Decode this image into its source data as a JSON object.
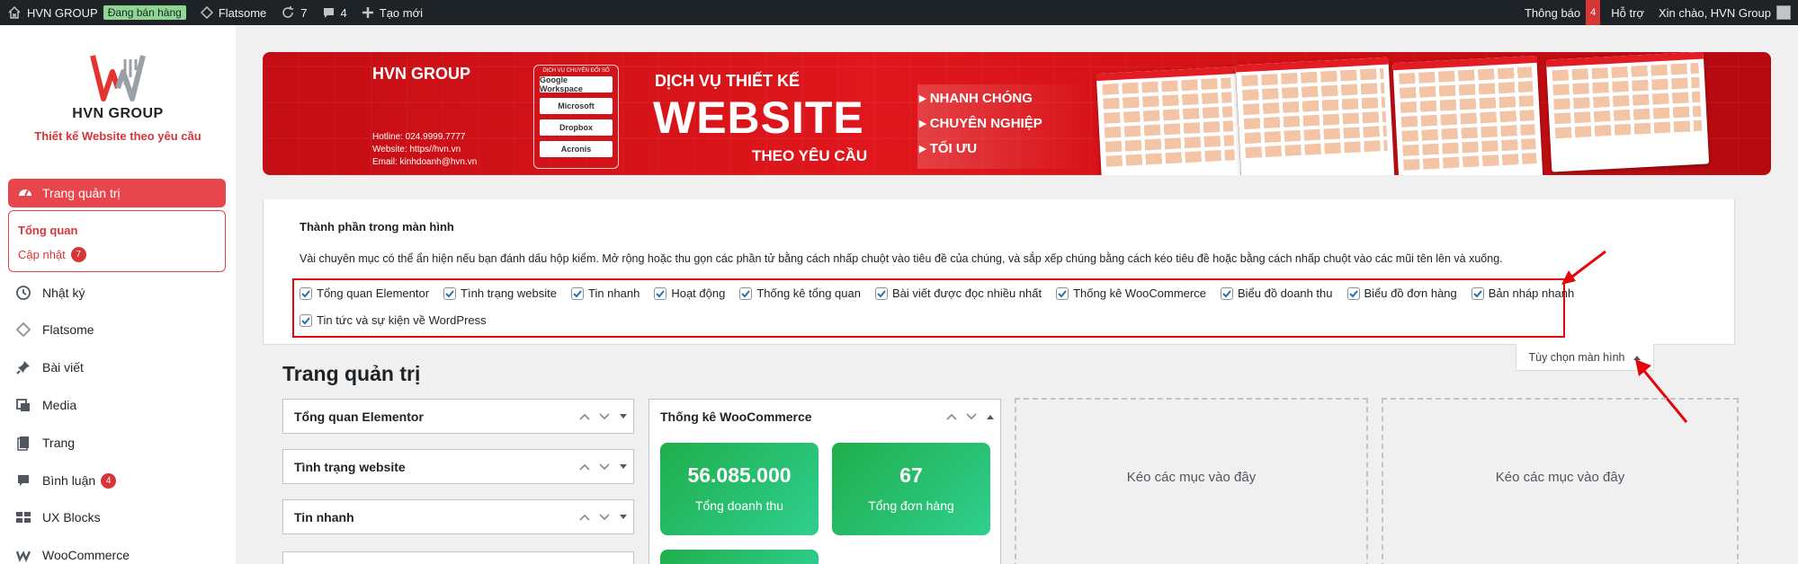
{
  "adminbar": {
    "site_name": "HVN GROUP",
    "site_status": "Đang bán hàng",
    "theme": "Flatsome",
    "updates": "7",
    "comments": "4",
    "new": "Tạo mới",
    "notifications": "Thông báo",
    "notifications_count": "4",
    "support": "Hỗ trợ",
    "greeting": "Xin chào, HVN Group"
  },
  "logo": {
    "name": "HVN GROUP",
    "tagline": "Thiết kế Website theo yêu cầu"
  },
  "sidebar": {
    "active": "Trang quản trị",
    "submenu": [
      {
        "label": "Tổng quan"
      },
      {
        "label": "Cập nhật",
        "count": "7"
      }
    ],
    "items": [
      {
        "label": "Nhật ký",
        "icon": "history-icon"
      },
      {
        "label": "Flatsome",
        "icon": "diamond-icon"
      },
      {
        "label": "Bài viết",
        "icon": "pin-icon"
      },
      {
        "label": "Media",
        "icon": "media-icon"
      },
      {
        "label": "Trang",
        "icon": "page-icon"
      },
      {
        "label": "Bình luận",
        "icon": "comment-icon",
        "count": "4"
      },
      {
        "label": "UX Blocks",
        "icon": "blocks-icon"
      },
      {
        "label": "WooCommerce",
        "icon": "woo-icon"
      }
    ]
  },
  "banner": {
    "brand": "HVN GROUP",
    "hotline": "Hotline: 024.9999.7777",
    "website": "Website: https//hvn.vn",
    "email": "Email: kinhdoanh@hvn.vn",
    "partners_title": "DỊCH VỤ CHUYÊN ĐỔI SỐ",
    "partners": [
      "Google Workspace",
      "Microsoft",
      "Dropbox",
      "Acronis"
    ],
    "service": "DỊCH VỤ THIẾT KẾ",
    "headline": "WEBSITE",
    "subline": "THEO YÊU CẦU",
    "features": [
      "NHANH CHÓNG",
      "CHUYÊN NGHIỆP",
      "TỐI ƯU"
    ]
  },
  "screen_options": {
    "title": "Thành phần trong màn hình",
    "description": "Vài chuyên mục có thể ẩn hiện nếu bạn đánh dấu hộp kiểm. Mở rộng hoặc thu gọn các phần tử bằng cách nhấp chuột vào tiêu đề của chúng, và sắp xếp chúng bằng cách kéo tiêu đề hoặc bằng cách nhấp chuột vào các mũi tên lên và xuống.",
    "row1": [
      "Tổng quan Elementor",
      "Tình trạng website",
      "Tin nhanh",
      "Hoạt động",
      "Thống kê tổng quan",
      "Bài viết được đọc nhiều nhất",
      "Thống kê WooCommerce",
      "Biểu đồ doanh thu",
      "Biểu đồ đơn hàng",
      "Bản nháp nhanh"
    ],
    "row2": [
      "Tin tức và sự kiện về WordPress"
    ],
    "tab_label": "Tùy chọn màn hình"
  },
  "page_title": "Trang quản trị",
  "widgets": {
    "col1": [
      "Tổng quan Elementor",
      "Tình trạng website",
      "Tin nhanh"
    ],
    "woo_title": "Thống kê WooCommerce",
    "revenue_value": "56.085.000",
    "revenue_label": "Tổng doanh thu",
    "orders_value": "67",
    "orders_label": "Tổng đơn hàng",
    "dropzone": "Kéo các mục vào đây"
  },
  "colors": {
    "adminbar": "#1d2327",
    "accent": "#e7464c",
    "highlight": "#e3070c",
    "stat_green": "#1fae4b"
  }
}
